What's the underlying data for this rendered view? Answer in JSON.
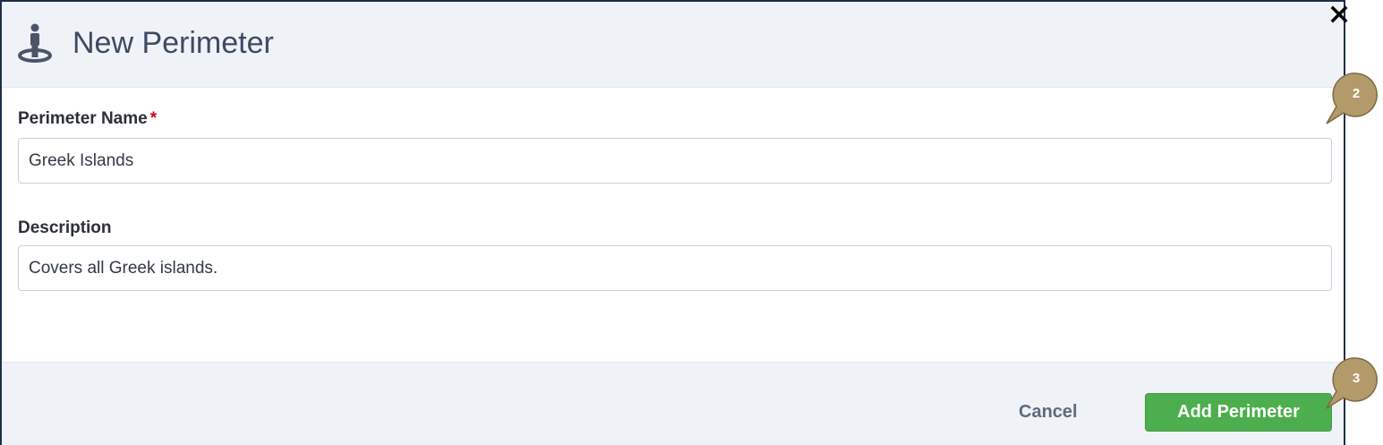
{
  "dialog": {
    "title": "New Perimeter",
    "icon": "person-location-icon",
    "close_icon": "close-icon"
  },
  "form": {
    "name_label": "Perimeter Name",
    "required_marker": "*",
    "name_value": "Greek Islands",
    "description_label": "Description",
    "description_value": "Covers all Greek islands."
  },
  "footer": {
    "cancel_label": "Cancel",
    "add_label": "Add Perimeter"
  },
  "callouts": [
    {
      "number": "2"
    },
    {
      "number": "3"
    }
  ],
  "colors": {
    "accent_green": "#4cae4c",
    "callout_fill": "#b39a6a",
    "required_red": "#d0021b"
  }
}
